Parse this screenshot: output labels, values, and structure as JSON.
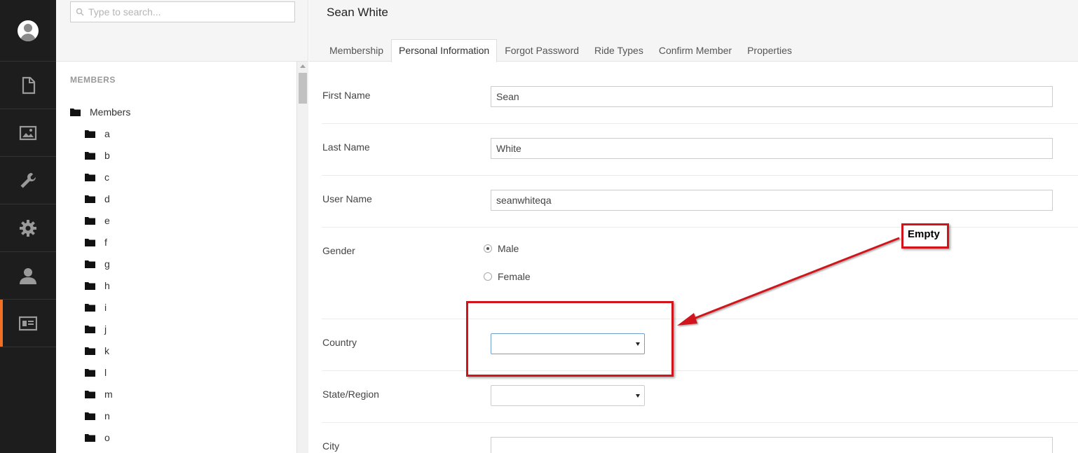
{
  "app_nav": {
    "items": [
      {
        "icon": "document-icon",
        "active": false
      },
      {
        "icon": "image-icon",
        "active": false
      },
      {
        "icon": "wrench-icon",
        "active": false
      },
      {
        "icon": "gear-icon",
        "active": false
      },
      {
        "icon": "user-icon",
        "active": false
      },
      {
        "icon": "member-card-icon",
        "active": true
      }
    ],
    "accent_color": "#f36f21"
  },
  "search": {
    "placeholder": "Type to search..."
  },
  "tree": {
    "section_title": "MEMBERS",
    "root_label": "Members",
    "children": [
      "a",
      "b",
      "c",
      "d",
      "e",
      "f",
      "g",
      "h",
      "i",
      "j",
      "k",
      "l",
      "m",
      "n",
      "o"
    ]
  },
  "header": {
    "title": "Sean White",
    "tabs": [
      {
        "label": "Membership",
        "active": false
      },
      {
        "label": "Personal Information",
        "active": true
      },
      {
        "label": "Forgot Password",
        "active": false
      },
      {
        "label": "Ride Types",
        "active": false
      },
      {
        "label": "Confirm Member",
        "active": false
      },
      {
        "label": "Properties",
        "active": false
      }
    ]
  },
  "form": {
    "first_name": {
      "label": "First Name",
      "value": "Sean"
    },
    "last_name": {
      "label": "Last Name",
      "value": "White"
    },
    "user_name": {
      "label": "User Name",
      "value": "seanwhiteqa"
    },
    "gender": {
      "label": "Gender",
      "options": [
        "Male",
        "Female"
      ],
      "selected": "Male"
    },
    "country": {
      "label": "Country",
      "value": ""
    },
    "state": {
      "label": "State/Region",
      "value": ""
    },
    "city": {
      "label": "City",
      "value": ""
    }
  },
  "annotation": {
    "text": "Empty",
    "color": "#d0141a"
  }
}
